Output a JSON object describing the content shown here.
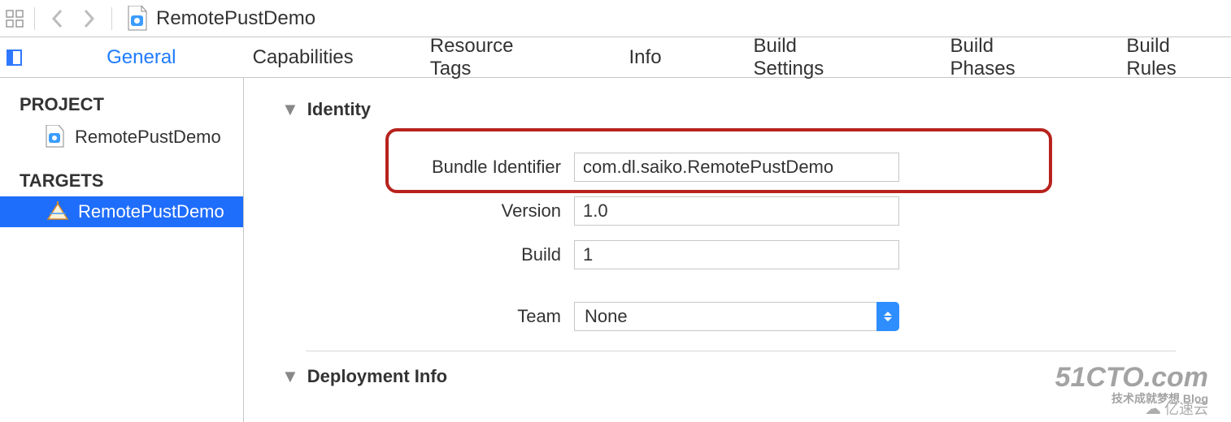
{
  "toolbar": {
    "project_name": "RemotePustDemo"
  },
  "tabs": {
    "general": "General",
    "capabilities": "Capabilities",
    "resource_tags": "Resource Tags",
    "info": "Info",
    "build_settings": "Build Settings",
    "build_phases": "Build Phases",
    "build_rules": "Build Rules"
  },
  "navigator": {
    "project_heading": "PROJECT",
    "project_item": "RemotePustDemo",
    "targets_heading": "TARGETS",
    "target_item": "RemotePustDemo"
  },
  "identity": {
    "heading": "Identity",
    "bundle_id_label": "Bundle Identifier",
    "bundle_id_value": "com.dl.saiko.RemotePustDemo",
    "version_label": "Version",
    "version_value": "1.0",
    "build_label": "Build",
    "build_value": "1",
    "team_label": "Team",
    "team_value": "None"
  },
  "deployment": {
    "heading": "Deployment Info"
  },
  "watermark1_big": "51CTO.com",
  "watermark1_small": "技术成就梦想   Blog",
  "watermark2": "亿速云"
}
